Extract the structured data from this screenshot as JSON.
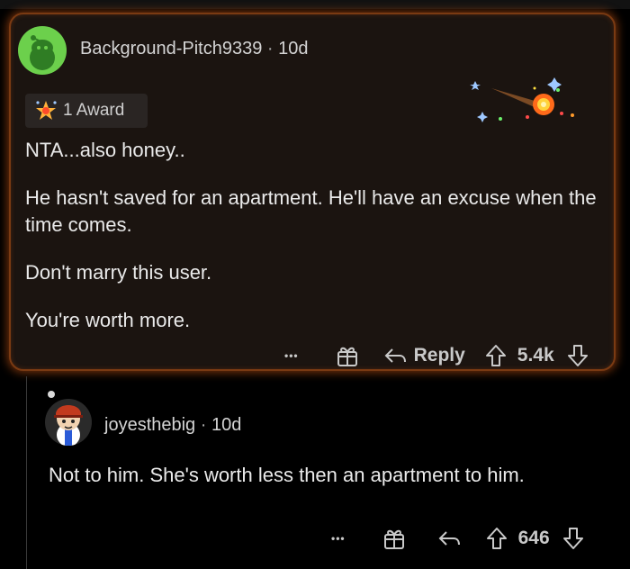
{
  "comment1": {
    "username": "Background-Pitch9339",
    "separator": "·",
    "age": "10d",
    "award_label": "1 Award",
    "paragraphs": [
      "NTA...also honey..",
      "He hasn't saved for an apartment. He'll have an excuse when the time comes.",
      "Don't marry this user.",
      "You're worth more."
    ],
    "more_label": "•••",
    "reply_label": "Reply",
    "score": "5.4k"
  },
  "comment2": {
    "username": "joyesthebig",
    "separator": "·",
    "age": "10d",
    "text": "Not to him. She's worth less then an apartment to him.",
    "more_label": "•••",
    "score": "646"
  },
  "colors": {
    "background": "#000000",
    "card_bg": "#1b1410",
    "card_glow": "#d25a14",
    "award_bg": "#2a2523",
    "avatar_green": "#6cd04c"
  },
  "icons": [
    "snoo-avatar-icon",
    "award-star-icon",
    "shooting-star-award-icon",
    "more-icon",
    "gift-icon",
    "reply-icon",
    "upvote-icon",
    "downvote-icon"
  ]
}
